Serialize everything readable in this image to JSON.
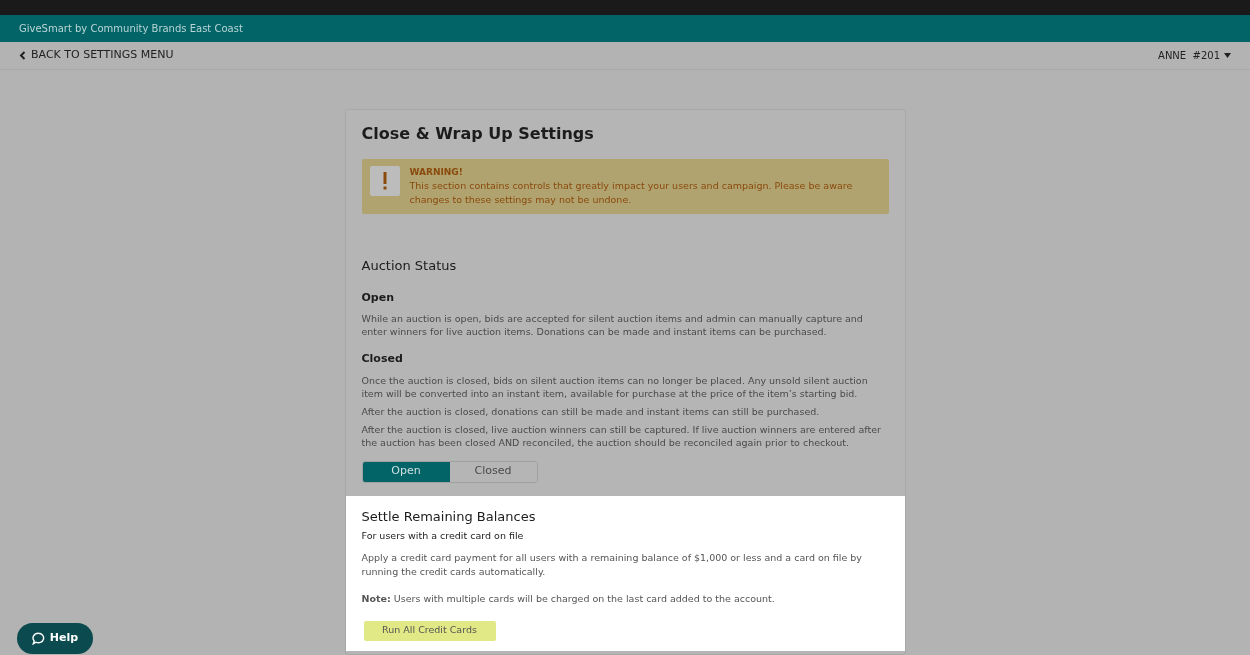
{
  "header": {
    "title": "GiveSmart by Community Brands East Coast"
  },
  "nav": {
    "back_label": "BACK TO SETTINGS MENU",
    "user_menu": "ANNE  #201"
  },
  "page": {
    "title": "Close & Wrap Up Settings"
  },
  "warning": {
    "title": "WARNING!",
    "message": "This section contains controls that greatly impact your users and campaign. Please be aware changes to these settings may not be undone."
  },
  "auction_status": {
    "heading": "Auction Status",
    "states": [
      {
        "title": "Open",
        "paragraphs": [
          "While an auction is open, bids are accepted for silent auction items and admin can manually capture and enter winners for live auction items. Donations can be made and instant items can be purchased."
        ]
      },
      {
        "title": "Closed",
        "paragraphs": [
          "Once the auction is closed, bids on silent auction items can no longer be placed. Any unsold silent auction item will be converted into an instant item, available for purchase at the price of the item’s starting bid.",
          "After the auction is closed, donations can still be made and instant items can still be purchased.",
          "After the auction is closed, live auction winners can still be captured. If live auction winners are entered after the auction has been closed AND reconciled, the auction should be reconciled again prior to checkout."
        ]
      }
    ],
    "toggle": [
      {
        "label": "Open",
        "selected": true
      },
      {
        "label": "Closed",
        "selected": false
      }
    ]
  },
  "settle": {
    "heading": "Settle Remaining Balances",
    "subtitle": "For users with a credit card on file",
    "description": "Apply a credit card payment for all users with a remaining balance of $1,000 or less and a card on file by running the credit cards automatically.",
    "note": "**Note:** Users with multiple cards will be charged on the last card added to the account.",
    "button": "Run All Credit Cards"
  },
  "help": {
    "label": "Help"
  }
}
